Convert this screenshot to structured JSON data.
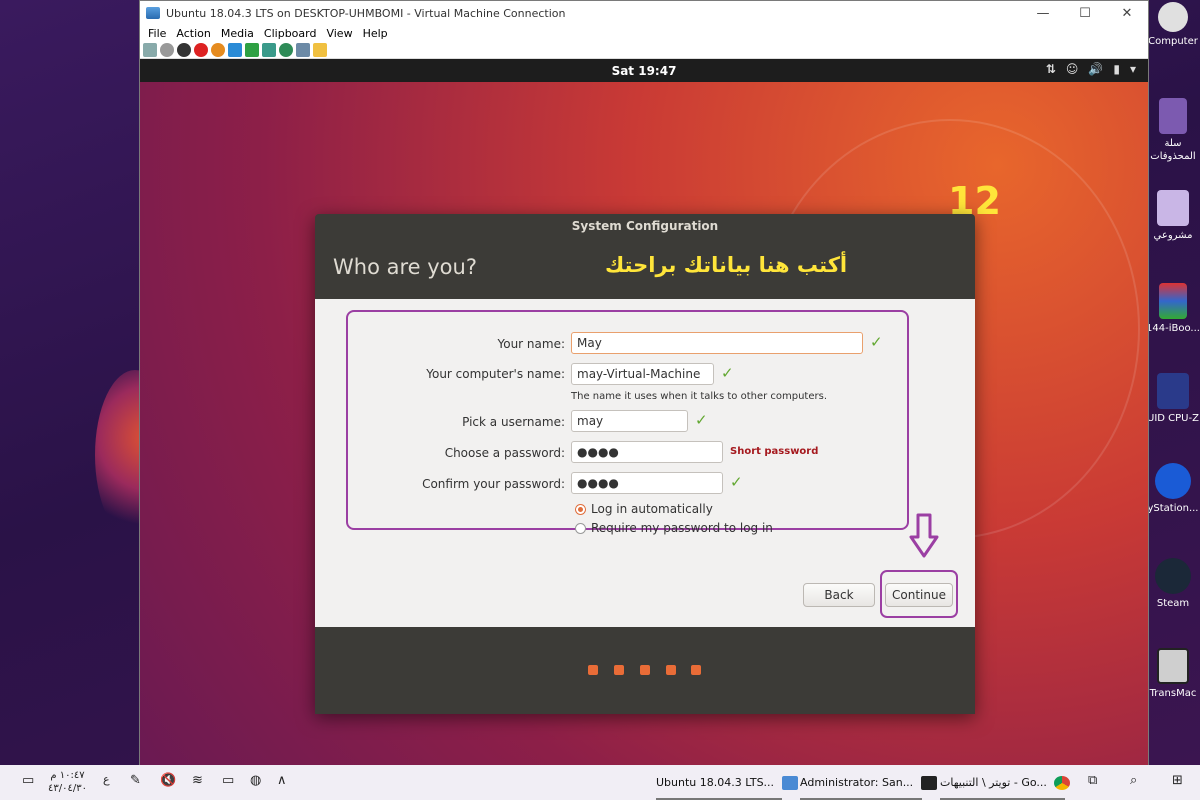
{
  "vm": {
    "title": "Ubuntu 18.04.3 LTS on DESKTOP-UHMBOMI - Virtual Machine Connection",
    "menu": [
      "File",
      "Action",
      "Media",
      "Clipboard",
      "View",
      "Help"
    ],
    "controls": {
      "minimize": "—",
      "maximize": "☐",
      "close": "✕"
    }
  },
  "ubuntu": {
    "clock": "Sat 19:47"
  },
  "annotation": {
    "step_number": "12",
    "arabic_caption": "أكتب هنا بياناتك براحتك"
  },
  "dialog": {
    "window_title": "System Configuration",
    "heading": "Who are you?",
    "fields": {
      "name_label": "Your name:",
      "name_value": "May",
      "computer_label": "Your computer's name:",
      "computer_value": "may-Virtual-Machine",
      "computer_hint": "The name it uses when it talks to other computers.",
      "username_label": "Pick a username:",
      "username_value": "may",
      "password_label": "Choose a password:",
      "password_value": "●●●●",
      "password_strength": "Short password",
      "confirm_label": "Confirm your password:",
      "confirm_value": "●●●●"
    },
    "login_options": {
      "auto": "Log in automatically",
      "require": "Require my password to log in"
    },
    "buttons": {
      "back": "Back",
      "continue": "Continue"
    }
  },
  "desktop_icons": [
    {
      "label": "Computer"
    },
    {
      "label": "سلة المحذوفات"
    },
    {
      "label": "مشروعي"
    },
    {
      "label": "144-iBoo..."
    },
    {
      "label": "UID CPU-Z"
    },
    {
      "label": "yStation..."
    },
    {
      "label": "Steam"
    },
    {
      "label": "TransMac"
    }
  ],
  "taskbar": {
    "time": "١٠:٤٧ م",
    "date": "٤٣/٠٤/٣٠",
    "lang": "ع",
    "tasks": [
      {
        "label": "Ubuntu 18.04.3 LTS..."
      },
      {
        "label": "Administrator: San..."
      },
      {
        "label": "تويتر \\ التنبيهات - Go..."
      }
    ]
  },
  "colors": {
    "accent": "#e96c37",
    "highlight": "#9b3fa3",
    "annotation": "#ffe53a",
    "check": "#63a832"
  }
}
